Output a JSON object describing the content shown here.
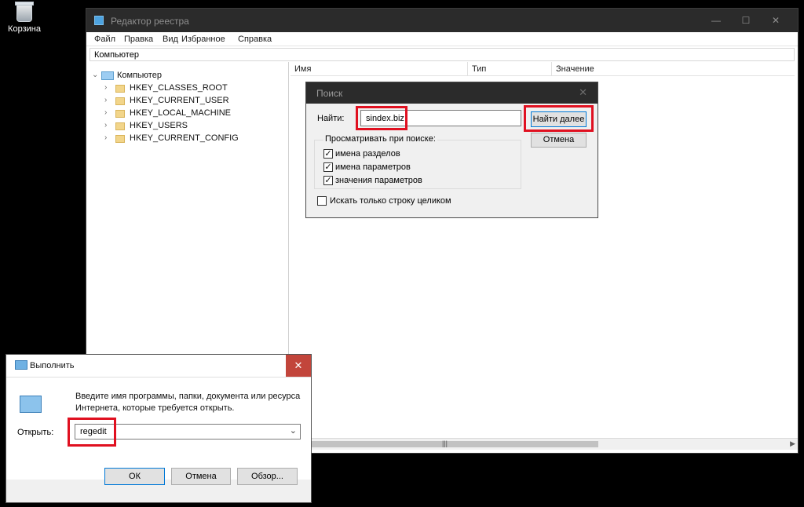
{
  "desktop": {
    "recycle_bin_label": "Корзина"
  },
  "regedit": {
    "title": "Редактор реестра",
    "controls": {
      "minimize": "—",
      "maximize": "☐",
      "close": "✕"
    },
    "menu": [
      "Файл",
      "Правка",
      "Вид",
      "Избранное",
      "Справка"
    ],
    "address": "Компьютер",
    "tree": {
      "root": "Компьютер",
      "items": [
        "HKEY_CLASSES_ROOT",
        "HKEY_CURRENT_USER",
        "HKEY_LOCAL_MACHINE",
        "HKEY_USERS",
        "HKEY_CURRENT_CONFIG"
      ]
    },
    "columns": [
      "Имя",
      "Тип",
      "Значение"
    ]
  },
  "find": {
    "title": "Поиск",
    "close": "✕",
    "find_label": "Найти:",
    "find_value": "sindex.biz",
    "find_next": "Найти далее",
    "cancel": "Отмена",
    "look_at": "Просматривать при поиске:",
    "options": [
      {
        "label": "имена разделов",
        "checked": true
      },
      {
        "label": "имена параметров",
        "checked": true
      },
      {
        "label": "значения параметров",
        "checked": true
      }
    ],
    "whole_string": {
      "label": "Искать только строку целиком",
      "checked": false
    }
  },
  "run": {
    "title": "Выполнить",
    "close": "✕",
    "description": "Введите имя программы, папки, документа или ресурса Интернета, которые требуется открыть.",
    "open_label": "Открыть:",
    "open_value": "regedit",
    "ok": "ОК",
    "cancel": "Отмена",
    "browse": "Обзор..."
  },
  "colors": {
    "highlight": "#e01020",
    "titlebar": "#2b2b2b",
    "run_close": "#c2453b"
  }
}
